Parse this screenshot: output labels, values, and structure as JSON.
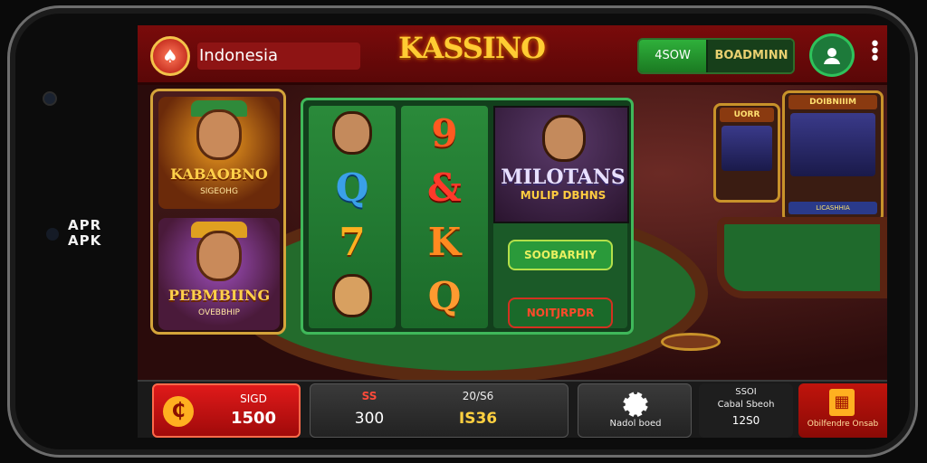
{
  "device": {
    "side_logo": "APR\nAPK"
  },
  "header": {
    "region": "Indonesia",
    "title": "KASSINO",
    "balance_primary": "4SOW",
    "balance_secondary": "BOADMINN"
  },
  "left_panel": {
    "promos": [
      {
        "title": "KABAOBNO",
        "subtitle": "SIGEOHG"
      },
      {
        "title": "PEBMBIING",
        "subtitle": "OVEBBHIP"
      }
    ]
  },
  "reels": {
    "column1": [
      "avatar",
      "Q",
      "7",
      "avatar"
    ],
    "column2": [
      "9",
      "&",
      "K",
      "Q"
    ],
    "feature": {
      "title": "MILOTANS",
      "subtitle": "MULIP DBHNS"
    },
    "badges": [
      "SOOBARHIY",
      "NOITJRPDR"
    ]
  },
  "machines": [
    {
      "title": "UORR",
      "label": ""
    },
    {
      "title": "DOIBNIIIM",
      "label": "LICASHHIA"
    }
  ],
  "bottom_bar": {
    "bet": {
      "label": "SIGD",
      "value": "1500"
    },
    "stats": {
      "label_left": "SS",
      "value_left": "300",
      "label_right": "20/S6",
      "value_right": "IS36"
    },
    "settings": {
      "label": "Nadol boed"
    },
    "info": {
      "line1": "SSOI",
      "line2": "Cabal Sbeoh",
      "value": "12S0"
    },
    "shop": {
      "label": "Obilfendre Onsab"
    }
  },
  "colors": {
    "accent_red": "#c0140c",
    "felt_green": "#236b2c",
    "gold": "#ffcc33"
  }
}
